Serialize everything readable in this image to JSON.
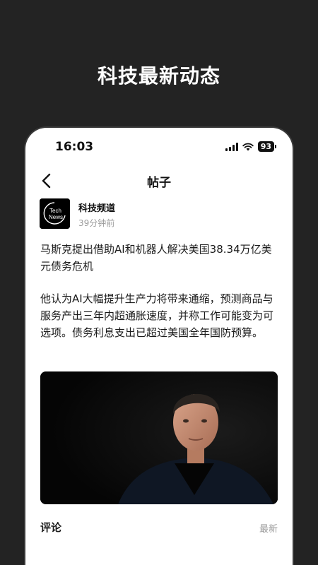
{
  "promo": {
    "title": "科技最新动态"
  },
  "status_bar": {
    "time": "16:03",
    "battery": "93",
    "icons": [
      "signal-icon",
      "wifi-icon",
      "battery-icon"
    ]
  },
  "nav": {
    "title": "帖子",
    "back_icon": "chevron-left-icon"
  },
  "author": {
    "name": "科技频道",
    "time": "39分钟前",
    "avatar_text_line1": "Tech",
    "avatar_text_line2": "News"
  },
  "post": {
    "title": "马斯克提出借助AI和机器人解决美国38.34万亿美元债务危机",
    "body": "他认为AI大幅提升生产力将带来通缩，预测商品与服务产出三年内超通胀速度，并称工作可能变为可选项。债务利息支出已超过美国全年国防预算。"
  },
  "comments": {
    "label": "评论",
    "sort": "最新"
  },
  "colors": {
    "background": "#232323",
    "card": "#ffffff",
    "text": "#1a1a1a",
    "muted": "#9b9b9b"
  }
}
